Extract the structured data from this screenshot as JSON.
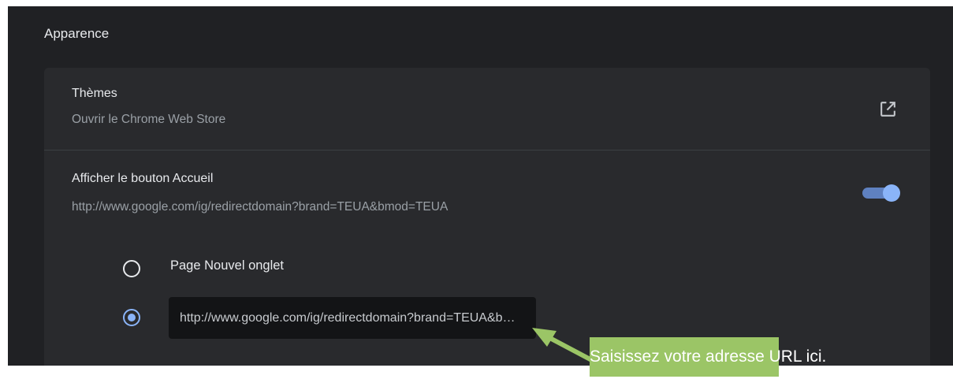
{
  "section": {
    "title": "Apparence"
  },
  "themes": {
    "title": "Thèmes",
    "subtitle": "Ouvrir le Chrome Web Store",
    "icon": "external-link-icon"
  },
  "home_button": {
    "title": "Afficher le bouton Accueil",
    "subtitle": "http://www.google.com/ig/redirectdomain?brand=TEUA&bmod=TEUA",
    "toggle_on": true,
    "options": [
      {
        "label": "Page Nouvel onglet",
        "selected": false
      },
      {
        "value": "http://www.google.com/ig/redirectdomain?brand=TEUA&bmod=TEUA",
        "selected": true
      }
    ]
  },
  "annotation": {
    "text": "Saisissez votre adresse URL ici.",
    "color": "#9bc566"
  },
  "colors": {
    "background": "#202124",
    "card": "#292a2d",
    "accent": "#8ab4f8",
    "text_primary": "#e8eaed",
    "text_secondary": "#9aa0a6"
  }
}
